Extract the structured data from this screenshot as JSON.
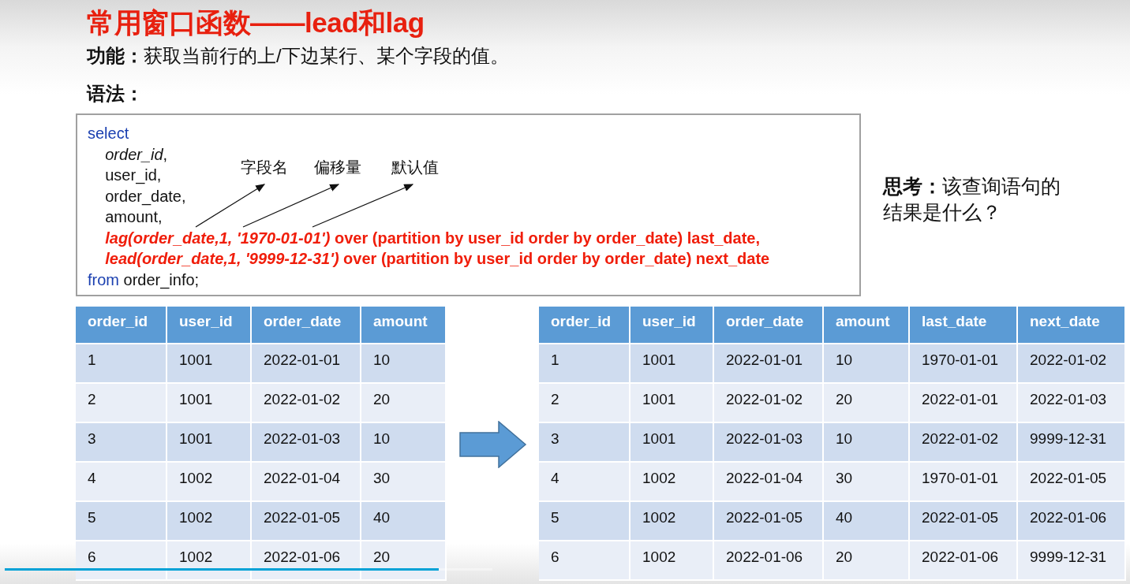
{
  "title": "常用窗口函数——lead和lag",
  "function": {
    "label": "功能：",
    "text": "获取当前行的上/下边某行、某个字段的值。"
  },
  "syntax": {
    "label": "语法："
  },
  "code": {
    "lines": [
      [
        {
          "kind": "keyword",
          "text": "select"
        }
      ],
      [
        {
          "kind": "emphasis",
          "text": "    order_id"
        },
        {
          "kind": "plain",
          "text": ","
        }
      ],
      [
        {
          "kind": "plain",
          "text": "    user_id,"
        }
      ],
      [
        {
          "kind": "plain",
          "text": "    order_date,"
        }
      ],
      [
        {
          "kind": "plain",
          "text": "    amount,"
        }
      ],
      [
        {
          "kind": "function",
          "text": "    lag(order_date,1, '1970-01-01')"
        },
        {
          "kind": "highlight",
          "text": " over (partition by user_id order by order_date) last_date,"
        }
      ],
      [
        {
          "kind": "function",
          "text": "    lead(order_date,1, '9999-12-31')"
        },
        {
          "kind": "highlight",
          "text": " over (partition by user_id order by order_date) next_date"
        }
      ],
      [
        {
          "kind": "keyword",
          "text": "from"
        },
        {
          "kind": "plain",
          "text": " order_info;"
        }
      ]
    ],
    "annotations": [
      "字段名",
      "偏移量",
      "默认值"
    ]
  },
  "question": {
    "label": "思考：",
    "text": "该查询语句的结果是什么？"
  },
  "source_table": {
    "columns": [
      "order_id",
      "user_id",
      "order_date",
      "amount"
    ],
    "rows": [
      [
        "1",
        "1001",
        "2022-01-01",
        "10"
      ],
      [
        "2",
        "1001",
        "2022-01-02",
        "20"
      ],
      [
        "3",
        "1001",
        "2022-01-03",
        "10"
      ],
      [
        "4",
        "1002",
        "2022-01-04",
        "30"
      ],
      [
        "5",
        "1002",
        "2022-01-05",
        "40"
      ],
      [
        "6",
        "1002",
        "2022-01-06",
        "20"
      ]
    ]
  },
  "result_table": {
    "columns": [
      "order_id",
      "user_id",
      "order_date",
      "amount",
      "last_date",
      "next_date"
    ],
    "rows": [
      [
        "1",
        "1001",
        "2022-01-01",
        "10",
        "1970-01-01",
        "2022-01-02"
      ],
      [
        "2",
        "1001",
        "2022-01-02",
        "20",
        "2022-01-01",
        "2022-01-03"
      ],
      [
        "3",
        "1001",
        "2022-01-03",
        "10",
        "2022-01-02",
        "9999-12-31"
      ],
      [
        "4",
        "1002",
        "2022-01-04",
        "30",
        "1970-01-01",
        "2022-01-05"
      ],
      [
        "5",
        "1002",
        "2022-01-05",
        "40",
        "2022-01-05",
        "2022-01-06"
      ],
      [
        "6",
        "1002",
        "2022-01-06",
        "20",
        "2022-01-06",
        "9999-12-31"
      ]
    ]
  },
  "progress": {
    "level": 0.89
  }
}
